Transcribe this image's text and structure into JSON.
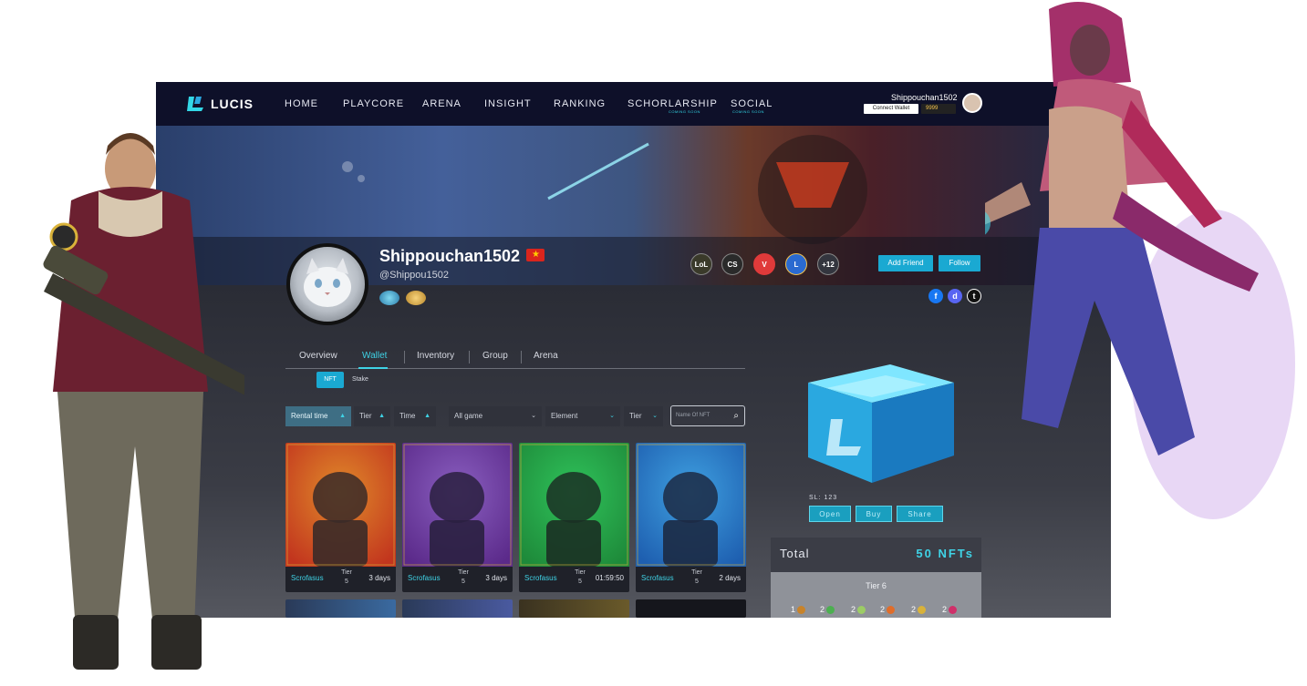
{
  "nav": {
    "logo": "LUCIS",
    "items": [
      {
        "label": "HOME",
        "sub": ""
      },
      {
        "label": "PLAYCORE",
        "sub": ""
      },
      {
        "label": "ARENA",
        "sub": ""
      },
      {
        "label": "INSIGHT",
        "sub": ""
      },
      {
        "label": "RANKING",
        "sub": ""
      },
      {
        "label": "SCHORLARSHIP",
        "sub": "COMING SOON"
      },
      {
        "label": "SOCIAL",
        "sub": "COMING SOON"
      }
    ],
    "username": "Shippouchan1502",
    "connect_wallet": "Connect Wallet",
    "balance": "9999"
  },
  "profile": {
    "name": "Shippouchan1502",
    "flag_star": "★",
    "handle": "@Shippou1502",
    "games": [
      "LoL",
      "CS",
      "V",
      "L"
    ],
    "more_games": "+12",
    "add_friend": "Add Friend",
    "follow": "Follow",
    "socials": [
      "f",
      "d",
      "t"
    ]
  },
  "tabs": [
    "Overview",
    "Wallet",
    "Inventory",
    "Group",
    "Arena"
  ],
  "subtabs": [
    "NFT",
    "Stake"
  ],
  "filters": {
    "rental_time": "Rental time",
    "tier": "Tier",
    "time": "Time",
    "all_game": "All game",
    "element": "Element",
    "tier2": "Tier",
    "search_placeholder": "Name Of NFT"
  },
  "cards": [
    {
      "name": "Scrofasus",
      "tier_label": "Tier",
      "tier": "5",
      "time": "3 days",
      "colors": [
        "#c2351e",
        "#e08a2a",
        "#3a2a28"
      ]
    },
    {
      "name": "Scrofasus",
      "tier_label": "Tier",
      "tier": "5",
      "time": "3 days",
      "colors": [
        "#5b2a8a",
        "#8a5fc0",
        "#2a2040"
      ]
    },
    {
      "name": "Scrofasus",
      "tier_label": "Tier",
      "tier": "5",
      "time": "01:59:50",
      "colors": [
        "#1e8a3a",
        "#2fc25a",
        "#1b3024"
      ]
    },
    {
      "name": "Scrofasus",
      "tier_label": "Tier",
      "tier": "5",
      "time": "2 days",
      "colors": [
        "#1e5fb0",
        "#3fa0e0",
        "#1c2a44"
      ]
    }
  ],
  "chest": {
    "sl": "SL: 123",
    "open": "Open",
    "buy": "Buy",
    "share": "Share"
  },
  "total": {
    "label": "Total",
    "value": "50 NFTs",
    "tier_title": "Tier 6",
    "tier_counts": [
      {
        "count": "1",
        "color": "#c8832a"
      },
      {
        "count": "2",
        "color": "#4caf50"
      },
      {
        "count": "2",
        "color": "#9ccc65"
      },
      {
        "count": "2",
        "color": "#e06d2a"
      },
      {
        "count": "2",
        "color": "#d9b23a"
      },
      {
        "count": "2",
        "color": "#d0306a"
      }
    ]
  },
  "colors": {
    "accent": "#3fd3e6",
    "nav_bg": "#0e1029",
    "button": "#1aa9d2"
  }
}
